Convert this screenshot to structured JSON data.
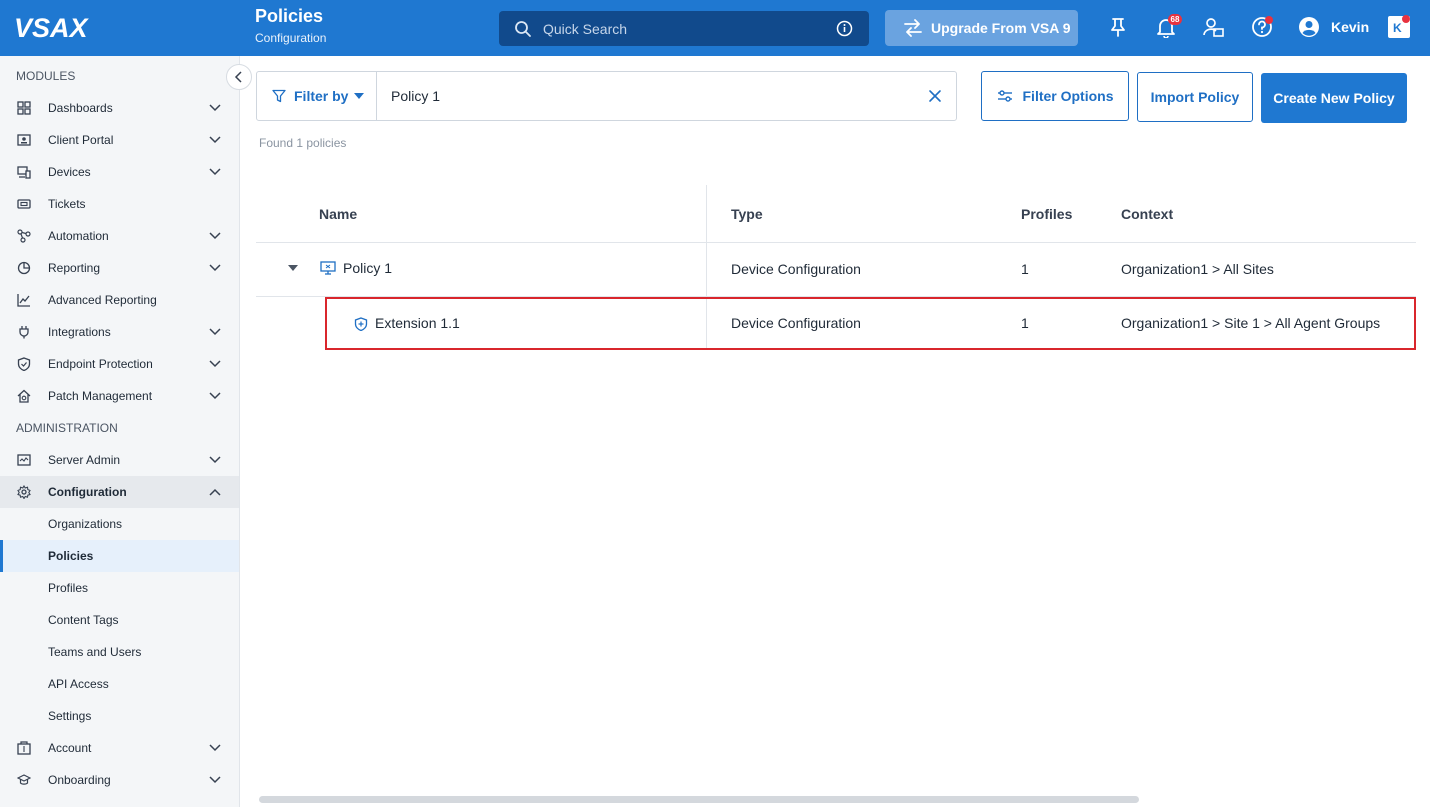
{
  "header": {
    "logo_text": "VSAX",
    "title": "Policies",
    "subtitle": "Configuration",
    "search_placeholder": "Quick Search",
    "upgrade_label": "Upgrade From VSA 9",
    "notification_count": "68",
    "user_name": "Kevin"
  },
  "sidebar": {
    "modules_label": "MODULES",
    "admin_label": "ADMINISTRATION",
    "modules": [
      {
        "label": "Dashboards",
        "icon": "dashboard-icon"
      },
      {
        "label": "Client Portal",
        "icon": "client-portal-icon"
      },
      {
        "label": "Devices",
        "icon": "devices-icon"
      },
      {
        "label": "Tickets",
        "icon": "ticket-icon"
      },
      {
        "label": "Automation",
        "icon": "automation-icon"
      },
      {
        "label": "Reporting",
        "icon": "reporting-icon"
      },
      {
        "label": "Advanced Reporting",
        "icon": "chart-icon"
      },
      {
        "label": "Integrations",
        "icon": "plug-icon"
      },
      {
        "label": "Endpoint Protection",
        "icon": "shield-icon"
      },
      {
        "label": "Patch Management",
        "icon": "home-gear-icon"
      }
    ],
    "admin": [
      {
        "label": "Server Admin",
        "icon": "server-icon"
      },
      {
        "label": "Configuration",
        "icon": "gear-icon"
      }
    ],
    "config_sub": [
      "Organizations",
      "Policies",
      "Profiles",
      "Content Tags",
      "Teams and Users",
      "API Access",
      "Settings"
    ],
    "bottom": [
      {
        "label": "Account",
        "icon": "account-icon"
      },
      {
        "label": "Onboarding",
        "icon": "graduation-icon"
      }
    ]
  },
  "toolbar": {
    "filter_by_label": "Filter by",
    "filter_value": "Policy 1",
    "filter_options_label": "Filter Options",
    "import_label": "Import Policy",
    "create_label": "Create New Policy",
    "found_text": "Found 1 policies"
  },
  "table": {
    "columns": [
      "Name",
      "Type",
      "Profiles",
      "Context"
    ],
    "rows": [
      {
        "name": "Policy 1",
        "type": "Device Configuration",
        "profiles": "1",
        "context": "Organization1 > All Sites"
      },
      {
        "name": "Extension 1.1",
        "type": "Device Configuration",
        "profiles": "1",
        "context": "Organization1 > Site 1 > All Agent Groups"
      }
    ]
  },
  "colors": {
    "brand": "#1f78d1",
    "highlight": "#d9262c"
  }
}
